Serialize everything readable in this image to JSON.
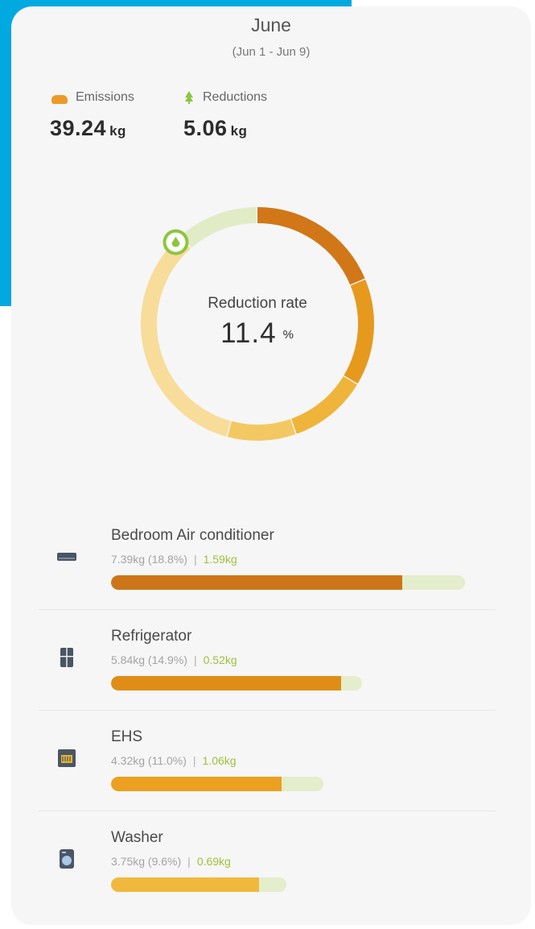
{
  "header": {
    "month": "June",
    "range": "(Jun 1 - Jun 9)"
  },
  "stats": {
    "emissions": {
      "label": "Emissions",
      "value": "39.24",
      "unit": "kg",
      "icon": "cloud-icon",
      "color": "#ec9a2a"
    },
    "reductions": {
      "label": "Reductions",
      "value": "5.06",
      "unit": "kg",
      "icon": "leaf-icon",
      "color": "#8cc63f"
    }
  },
  "donut": {
    "label": "Reduction rate",
    "value": "11.4",
    "unit": "%",
    "reduction_fraction": 0.114,
    "segments": [
      {
        "name": "Bedroom Air conditioner",
        "color": "#d17717",
        "fraction": 0.188
      },
      {
        "name": "Refrigerator",
        "color": "#e59a1e",
        "fraction": 0.149
      },
      {
        "name": "EHS",
        "color": "#efb43a",
        "fraction": 0.11
      },
      {
        "name": "Washer",
        "color": "#f3c862",
        "fraction": 0.096
      },
      {
        "name": "Other",
        "color": "#f7dc9a",
        "fraction": 0.343
      },
      {
        "name": "Reductions",
        "color": "#e1ecc6",
        "fraction": 0.114
      }
    ]
  },
  "devices": [
    {
      "name": "Bedroom Air conditioner",
      "detail": "7.39kg (18.8%)",
      "reduction": "1.59kg",
      "icon": "air-conditioner-icon",
      "bar_color": "#cc7619",
      "emission_kg": 7.39,
      "reduction_kg": 1.59
    },
    {
      "name": "Refrigerator",
      "detail": "5.84kg (14.9%)",
      "reduction": "0.52kg",
      "icon": "refrigerator-icon",
      "bar_color": "#e08d17",
      "emission_kg": 5.84,
      "reduction_kg": 0.52
    },
    {
      "name": "EHS",
      "detail": "4.32kg (11.0%)",
      "reduction": "1.06kg",
      "icon": "ehs-icon",
      "bar_color": "#eba020",
      "emission_kg": 4.32,
      "reduction_kg": 1.06
    },
    {
      "name": "Washer",
      "detail": "3.75kg (9.6%)",
      "reduction": "0.69kg",
      "icon": "washer-icon",
      "bar_color": "#f0b93e",
      "emission_kg": 3.75,
      "reduction_kg": 0.69
    }
  ]
}
